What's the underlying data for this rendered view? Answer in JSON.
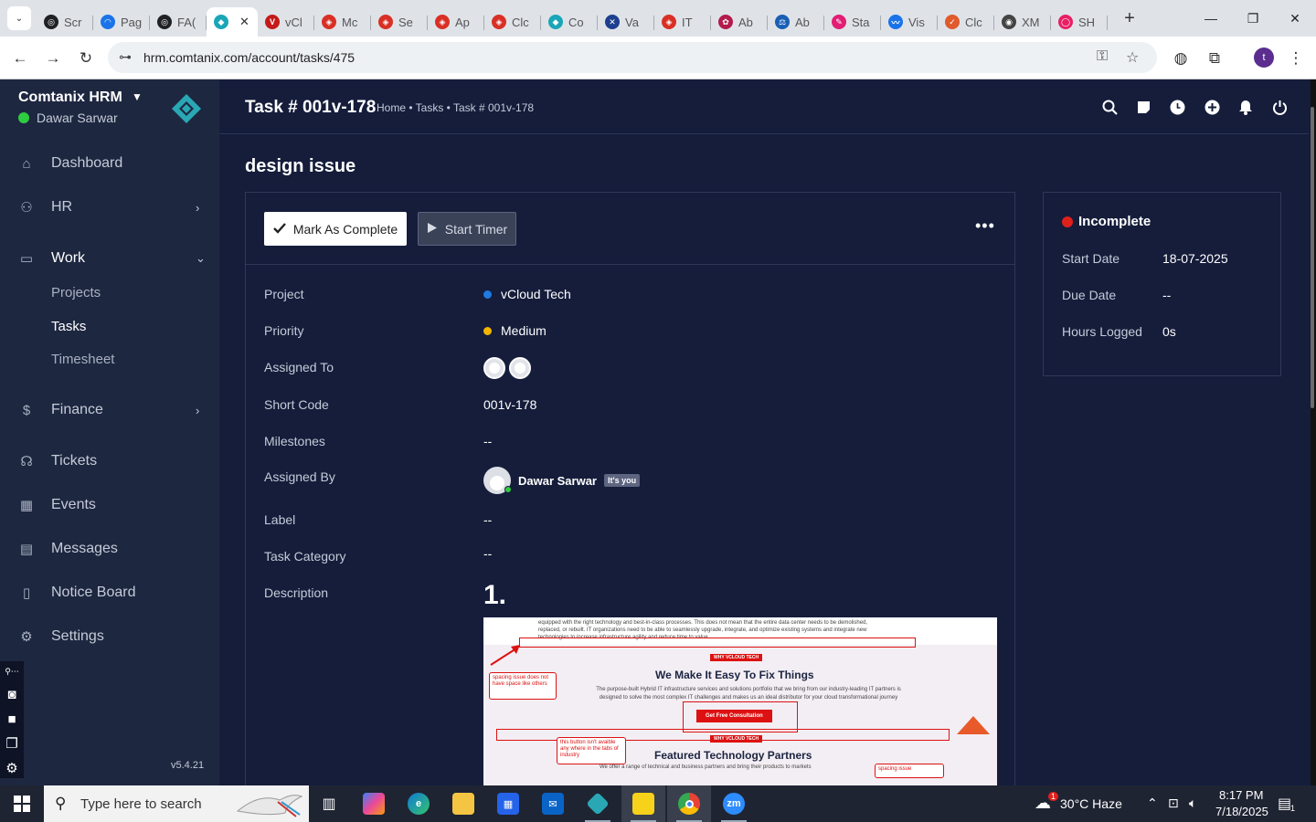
{
  "browser": {
    "tabs": [
      {
        "label": "Scr",
        "color": "#202124",
        "glyph": "◎"
      },
      {
        "label": "Pag",
        "color": "#1a73e8",
        "glyph": "◠"
      },
      {
        "label": "FA(",
        "color": "#202124",
        "glyph": "◎"
      },
      {
        "label": "",
        "color": "#1aa6b7",
        "glyph": "◆",
        "active": true
      },
      {
        "label": "vCl",
        "color": "#c41a1a",
        "glyph": "V"
      },
      {
        "label": "Mc",
        "color": "#d93025",
        "glyph": "◈"
      },
      {
        "label": "Se",
        "color": "#d93025",
        "glyph": "◈"
      },
      {
        "label": "Ap",
        "color": "#d93025",
        "glyph": "◈"
      },
      {
        "label": "Clc",
        "color": "#d93025",
        "glyph": "◈"
      },
      {
        "label": "Co",
        "color": "#1aa6b7",
        "glyph": "◆"
      },
      {
        "label": "Va",
        "color": "#1d3f8f",
        "glyph": "✕"
      },
      {
        "label": "IT",
        "color": "#d93025",
        "glyph": "◈"
      },
      {
        "label": "Ab",
        "color": "#b31b4c",
        "glyph": "✿"
      },
      {
        "label": "Ab",
        "color": "#1a5fb4",
        "glyph": "⚖"
      },
      {
        "label": "Sta",
        "color": "#e11d74",
        "glyph": "✎"
      },
      {
        "label": "Vis",
        "color": "#1a73e8",
        "glyph": "〰"
      },
      {
        "label": "Clc",
        "color": "#e05a2b",
        "glyph": "✓"
      },
      {
        "label": "XM",
        "color": "#444",
        "glyph": "◉"
      },
      {
        "label": "SH",
        "color": "#e91e63",
        "glyph": "◯"
      }
    ],
    "url": "hrm.comtanix.com/account/tasks/475",
    "profile_initial": "t"
  },
  "sidebar": {
    "brand": "Comtanix HRM",
    "user": "Dawar Sarwar",
    "items": [
      {
        "label": "Dashboard",
        "icon": "⌂",
        "name": "dashboard"
      },
      {
        "label": "HR",
        "icon": "⚇",
        "name": "hr",
        "chevron": "›"
      },
      {
        "label": "Work",
        "icon": "▭",
        "name": "work",
        "chevron": "⌄"
      },
      {
        "label": "Finance",
        "icon": "$",
        "name": "finance",
        "chevron": "›"
      },
      {
        "label": "Tickets",
        "icon": "☊",
        "name": "tickets"
      },
      {
        "label": "Events",
        "icon": "▦",
        "name": "events"
      },
      {
        "label": "Messages",
        "icon": "▤",
        "name": "messages"
      },
      {
        "label": "Notice Board",
        "icon": "▯",
        "name": "notice-board"
      },
      {
        "label": "Settings",
        "icon": "⚙",
        "name": "settings"
      }
    ],
    "work_sub": [
      "Projects",
      "Tasks",
      "Timesheet"
    ],
    "version": "v5.4.21"
  },
  "header": {
    "title": "Task # 001v-178",
    "breadcrumb": "Home • Tasks • Task # 001v-178"
  },
  "task": {
    "heading": "design issue",
    "mark_complete_label": "Mark As Complete",
    "start_timer_label": "Start Timer",
    "more_label": "•••",
    "fields": {
      "project": {
        "label": "Project",
        "value": "vCloud Tech",
        "dot_color": "#1e7be0"
      },
      "priority": {
        "label": "Priority",
        "value": "Medium",
        "dot_color": "#f5b400"
      },
      "assigned_to": {
        "label": "Assigned To"
      },
      "short_code": {
        "label": "Short Code",
        "value": "001v-178"
      },
      "milestones": {
        "label": "Milestones",
        "value": "--"
      },
      "assigned_by": {
        "label": "Assigned By",
        "value": "Dawar Sarwar",
        "badge": "It's you"
      },
      "label": {
        "label": "Label",
        "value": "--"
      },
      "task_category": {
        "label": "Task Category",
        "value": "--"
      },
      "description": {
        "label": "Description",
        "number": "1."
      }
    },
    "desc_image": {
      "top_text_1": "equipped with the right technology and best-in-class processes. This does not mean that the entire data center needs to be demolished,",
      "top_text_2": "replaced, or rebuilt. IT organizations need to be able to seamlessly upgrade, integrate, and optimize existing systems and integrate new",
      "top_text_3": "technologies to increase infrastructure agility and reduce time to value.",
      "tag_1": "WHY VCLOUD TECH",
      "heading_1": "We Make It Easy To Fix Things",
      "sub_1": "The purpose-built Hybrid IT infrastructure services and solutions portfolio that we bring from our industry-leading IT partners is",
      "sub_2": "designed to solve the most complex IT challenges and makes us an ideal distributor for your cloud transformational journey",
      "cta": "Get Free Consultation",
      "tag_2": "WHY VCLOUD TECH",
      "heading_2": "Featured Technology Partners",
      "sub_3": "We offer a range of technical and business partners and bring their products to markets",
      "note_1": "spacing issue does not have space like others",
      "note_2": "this button isn't avaible any where in the tabs of industry",
      "note_3": "spacing issue"
    }
  },
  "status": {
    "title": "Incomplete",
    "start_date_label": "Start Date",
    "start_date": "18-07-2025",
    "due_date_label": "Due Date",
    "due_date": "--",
    "hours_label": "Hours Logged",
    "hours": "0s"
  },
  "taskbar": {
    "search_placeholder": "Type here to search",
    "weather": "30°C  Haze",
    "weather_badge": "1",
    "time": "8:17 PM",
    "date": "7/18/2025",
    "notification_count": "1"
  }
}
